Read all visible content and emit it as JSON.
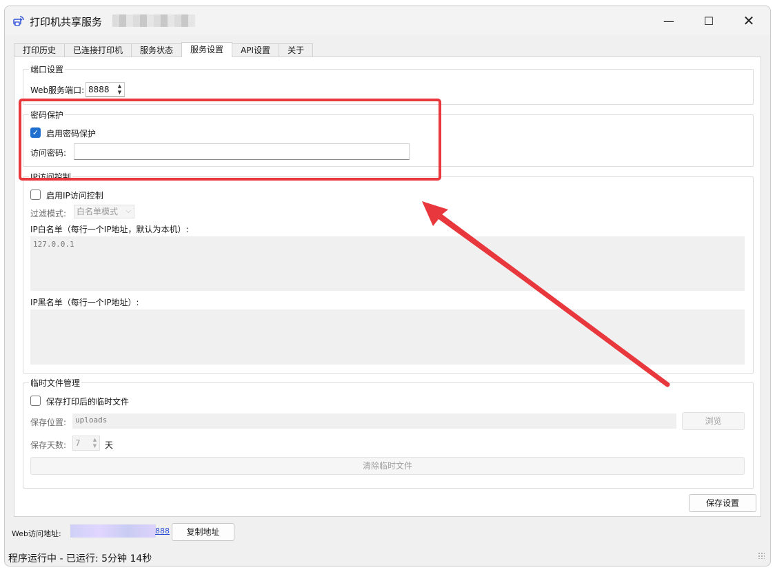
{
  "window": {
    "title": "打印机共享服务",
    "controls": {
      "minimize": "—",
      "maximize": "☐",
      "close": "✕"
    }
  },
  "tabs": [
    {
      "label": "打印历史",
      "active": false
    },
    {
      "label": "已连接打印机",
      "active": false
    },
    {
      "label": "服务状态",
      "active": false
    },
    {
      "label": "服务设置",
      "active": true
    },
    {
      "label": "API设置",
      "active": false
    },
    {
      "label": "关于",
      "active": false
    }
  ],
  "port_group": {
    "title": "端口设置",
    "port_label": "Web服务端口:",
    "port_value": "8888"
  },
  "password_group": {
    "title": "密码保护",
    "enable_label": "启用密码保护",
    "enabled": true,
    "password_label": "访问密码:",
    "password_value": ""
  },
  "ip_group": {
    "title": "IP访问控制",
    "enable_label": "启用IP访问控制",
    "enabled": false,
    "filter_label": "过滤模式:",
    "filter_value": "白名单模式",
    "whitelist_label": "IP白名单（每行一个IP地址，默认为本机）:",
    "whitelist_value": "127.0.0.1",
    "blacklist_label": "IP黑名单（每行一个IP地址）:",
    "blacklist_value": ""
  },
  "temp_group": {
    "title": "临时文件管理",
    "save_label": "保存打印后的临时文件",
    "save_enabled": false,
    "location_label": "保存位置:",
    "location_value": "uploads",
    "browse_label": "浏览",
    "days_label": "保存天数:",
    "days_value": "7",
    "days_unit": "天",
    "clear_label": "清除临时文件"
  },
  "save_settings_label": "保存设置",
  "footer": {
    "url_label": "Web访问地址:",
    "url_tail": "888",
    "copy_label": "复制地址",
    "status": "程序运行中 - 已运行: 5分钟 14秒"
  },
  "colors": {
    "accent": "#1f6fd1",
    "annotation": "#e8383d"
  }
}
